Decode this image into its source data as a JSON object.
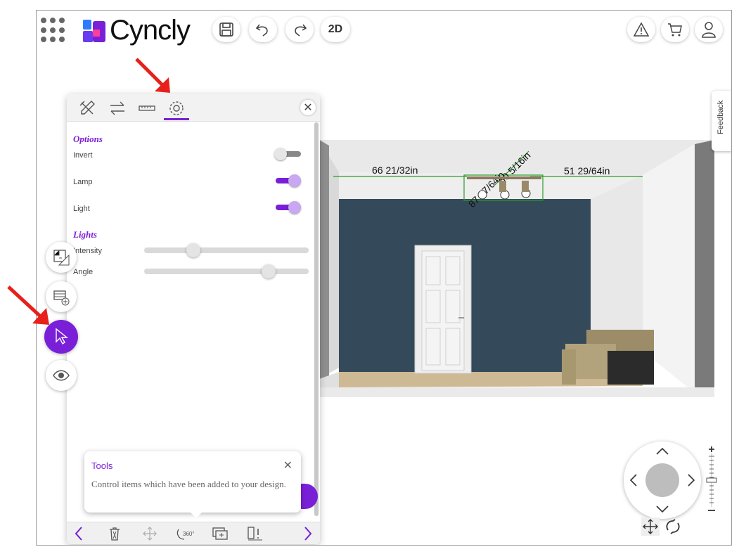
{
  "header": {
    "brand": "Cyncly",
    "buttons": [
      {
        "name": "save",
        "icon": "save-icon"
      },
      {
        "name": "undo",
        "icon": "undo-icon"
      },
      {
        "name": "redo",
        "icon": "redo-icon"
      },
      {
        "name": "view-mode",
        "label": "2D"
      }
    ],
    "right_buttons": [
      "warning-icon",
      "cart-icon",
      "user-icon"
    ]
  },
  "panel": {
    "tabs": [
      "tools-icon",
      "swap-icon",
      "ruler-icon",
      "settings-icon"
    ],
    "active_tab": "settings-icon",
    "options_title": "Options",
    "options": [
      {
        "label": "Invert",
        "on": false
      },
      {
        "label": "Lamp",
        "on": true
      },
      {
        "label": "Light",
        "on": true
      }
    ],
    "lights_title": "Lights",
    "sliders": [
      {
        "label": "Intensity",
        "value": 0.28
      },
      {
        "label": "Angle",
        "value": 0.78
      }
    ],
    "bottom_tools": [
      "prev-icon",
      "delete-icon",
      "move-icon",
      "rotate-360-icon",
      "add-frame-icon",
      "warning-item-icon",
      "next-icon"
    ]
  },
  "tooltip": {
    "title": "Tools",
    "body": "Control items which have been added to your design."
  },
  "scene": {
    "dimensions": [
      "66 21/32in",
      "51 29/64in",
      "60 5/16in",
      "87 47/64in"
    ]
  },
  "feedback_label": "Feedback",
  "colors": {
    "accent": "#7a1fd8",
    "wall": "#344a5a"
  }
}
